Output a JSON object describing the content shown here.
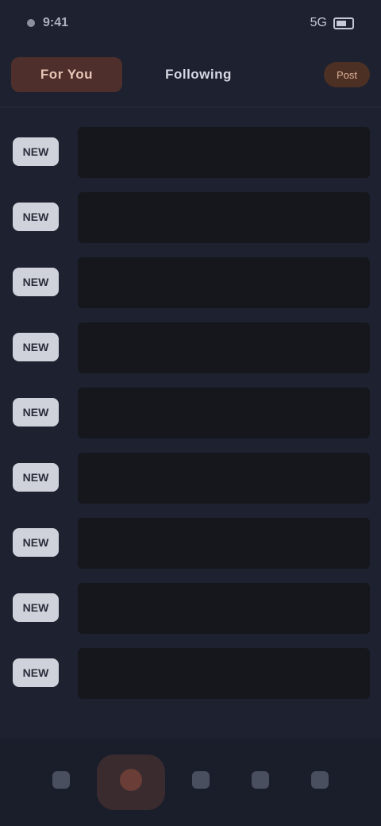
{
  "status_bar": {
    "time": "9:41",
    "carrier_dot": "status-dot",
    "right_text": "5G"
  },
  "tabs": [
    {
      "label": "For You",
      "active": true
    },
    {
      "label": "Following",
      "active": false
    }
  ],
  "top_action": {
    "label": "Post"
  },
  "list": {
    "rows": [
      {
        "badge": "NEW",
        "title": "",
        "sub": "",
        "meta": ""
      },
      {
        "badge": "NEW",
        "title": "",
        "sub": "",
        "meta": ""
      },
      {
        "badge": "NEW",
        "title": "",
        "sub": "",
        "meta": ""
      },
      {
        "badge": "NEW",
        "title": "",
        "sub": "",
        "meta": ""
      },
      {
        "badge": "NEW",
        "title": "",
        "sub": "",
        "meta": ""
      },
      {
        "badge": "NEW",
        "title": "",
        "sub": "",
        "meta": ""
      },
      {
        "badge": "NEW",
        "title": "",
        "sub": "",
        "meta": ""
      },
      {
        "badge": "NEW",
        "title": "",
        "sub": "",
        "meta": ""
      },
      {
        "badge": "NEW",
        "title": "",
        "sub": "",
        "meta": ""
      }
    ]
  },
  "bottom_nav": {
    "items": [
      {
        "label": "",
        "icon": "home-icon"
      },
      {
        "label": "",
        "icon": "plus-icon"
      },
      {
        "label": "",
        "icon": "search-icon"
      },
      {
        "label": "",
        "icon": "inbox-icon"
      },
      {
        "label": "",
        "icon": "profile-icon"
      }
    ]
  },
  "colors": {
    "background": "#1d2130",
    "accent": "#4e2f2b",
    "badge_bg": "#cfd2da"
  }
}
